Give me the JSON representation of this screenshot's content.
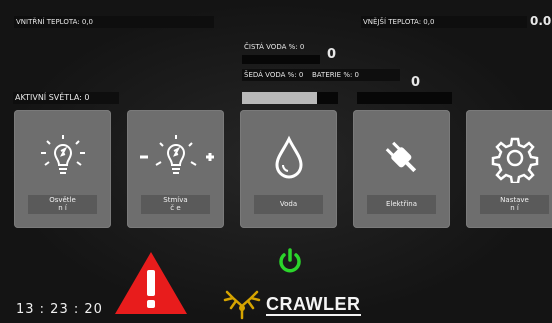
{
  "status": {
    "inside_temp": "VNITŘNÍ TEPLOTA: 0,0",
    "outside_temp": "VNĚJŠÍ TEPLOTA: 0,0",
    "outside_temp_big": "0.0",
    "active_lights": "AKTIVNÍ SVĚTLA: 0",
    "clean_water": "ČISTÁ VODA %: 0",
    "clean_water_big": "0",
    "grey_water": "ŠEDÁ VODA %: 0",
    "battery": "BATERIE %: 0",
    "battery_big": "0",
    "clean_water_level": 0.78,
    "battery_level": 0
  },
  "tiles": [
    {
      "id": "lights",
      "label": "Osvětle\nn í",
      "icon": "lightbulb-icon"
    },
    {
      "id": "dimmer",
      "label": "Stmíva\nč e",
      "icon": "dimmer-icon"
    },
    {
      "id": "water",
      "label": "Voda",
      "icon": "water-drop-icon"
    },
    {
      "id": "electric",
      "label": "Elektřina",
      "icon": "plug-icon"
    },
    {
      "id": "settings",
      "label": "Nastave\nn í",
      "icon": "gear-icon"
    }
  ],
  "clock": "13 : 23 : 20",
  "brand": "CRAWLER",
  "colors": {
    "power": "#2bd52b",
    "warning": "#e81c1c",
    "tile": "#6e6e6e"
  }
}
